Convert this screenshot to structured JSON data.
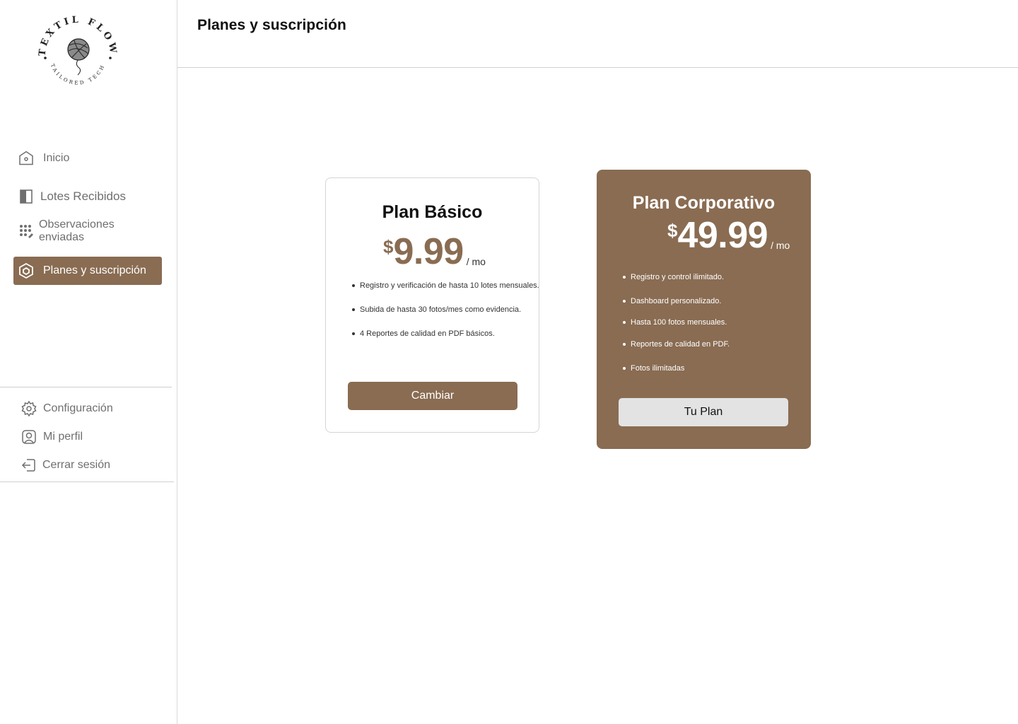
{
  "brand": {
    "name": "TEXTIL FLOW",
    "tagline": "TAILORED TECH"
  },
  "header": {
    "title": "Planes y suscripción"
  },
  "sidebar": {
    "items": [
      {
        "label": "Inicio",
        "icon": "home-icon"
      },
      {
        "label": "Lotes Recibidos",
        "icon": "book-icon"
      },
      {
        "label": "Observaciones enviadas",
        "icon": "grid-dots-icon"
      },
      {
        "label": "Planes y suscripción",
        "icon": "cube-icon",
        "active": true
      }
    ],
    "bottom_items": [
      {
        "label": "Configuración",
        "icon": "gear-icon"
      },
      {
        "label": "Mi perfil",
        "icon": "user-icon"
      },
      {
        "label": "Cerrar sesión",
        "icon": "logout-icon"
      }
    ]
  },
  "plans": [
    {
      "name": "Plan Básico",
      "currency": "$",
      "price": "9.99",
      "period": "/ mo",
      "features": [
        "Registro y verificación de hasta 10 lotes mensuales.",
        "Subida de hasta 30 fotos/mes como evidencia.",
        "4 Reportes de calidad en PDF básicos."
      ],
      "button": "Cambiar"
    },
    {
      "name": "Plan Corporativo",
      "currency": "$",
      "price": "49.99",
      "period": "/ mo",
      "features": [
        "Registro y control ilimitado.",
        "Dashboard personalizado.",
        "Hasta 100 fotos mensuales.",
        "Reportes de calidad en PDF.",
        "Fotos ilimitadas"
      ],
      "button": "Tu Plan"
    }
  ],
  "colors": {
    "accent": "#896c52",
    "muted_text": "#6f6f6f",
    "current_plan_button": "#e3e3e3"
  }
}
